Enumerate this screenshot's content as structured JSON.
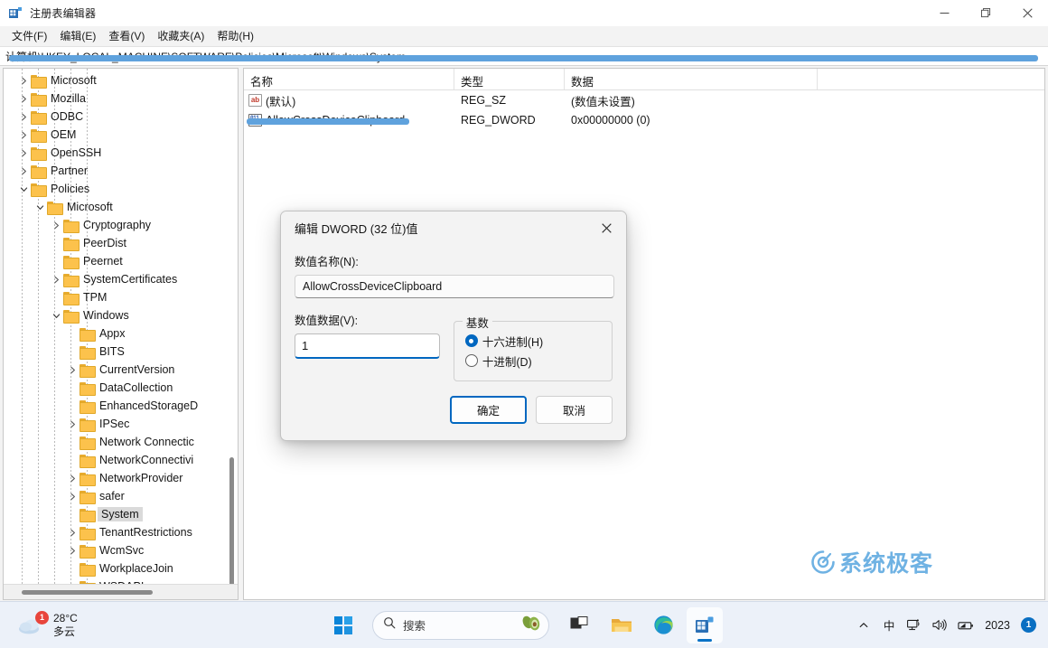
{
  "window": {
    "title": "注册表编辑器",
    "icon": "regedit-icon",
    "controls": {
      "minimize": "—",
      "maximize": "❐",
      "close": "✕"
    }
  },
  "menubar": {
    "items": [
      {
        "label": "文件(F)",
        "name": "menu-file"
      },
      {
        "label": "编辑(E)",
        "name": "menu-edit"
      },
      {
        "label": "查看(V)",
        "name": "menu-view"
      },
      {
        "label": "收藏夹(A)",
        "name": "menu-favorites"
      },
      {
        "label": "帮助(H)",
        "name": "menu-help"
      }
    ]
  },
  "address": {
    "path": "计算机\\HKEY_LOCAL_MACHINE\\SOFTWARE\\Policies\\Microsoft\\Windows\\System"
  },
  "tree": {
    "items": [
      {
        "label": "Microsoft",
        "indent": 1,
        "twisty": "collapsed"
      },
      {
        "label": "Mozilla",
        "indent": 1,
        "twisty": "collapsed"
      },
      {
        "label": "ODBC",
        "indent": 1,
        "twisty": "collapsed"
      },
      {
        "label": "OEM",
        "indent": 1,
        "twisty": "collapsed"
      },
      {
        "label": "OpenSSH",
        "indent": 1,
        "twisty": "collapsed"
      },
      {
        "label": "Partner",
        "indent": 1,
        "twisty": "collapsed"
      },
      {
        "label": "Policies",
        "indent": 1,
        "twisty": "expanded"
      },
      {
        "label": "Microsoft",
        "indent": 2,
        "twisty": "expanded"
      },
      {
        "label": "Cryptography",
        "indent": 3,
        "twisty": "collapsed"
      },
      {
        "label": "PeerDist",
        "indent": 3,
        "twisty": "none"
      },
      {
        "label": "Peernet",
        "indent": 3,
        "twisty": "none"
      },
      {
        "label": "SystemCertificates",
        "indent": 3,
        "twisty": "collapsed"
      },
      {
        "label": "TPM",
        "indent": 3,
        "twisty": "none"
      },
      {
        "label": "Windows",
        "indent": 3,
        "twisty": "expanded"
      },
      {
        "label": "Appx",
        "indent": 4,
        "twisty": "none"
      },
      {
        "label": "BITS",
        "indent": 4,
        "twisty": "none"
      },
      {
        "label": "CurrentVersion",
        "indent": 4,
        "twisty": "collapsed"
      },
      {
        "label": "DataCollection",
        "indent": 4,
        "twisty": "none"
      },
      {
        "label": "EnhancedStorageD",
        "indent": 4,
        "twisty": "none"
      },
      {
        "label": "IPSec",
        "indent": 4,
        "twisty": "collapsed"
      },
      {
        "label": "Network Connectic",
        "indent": 4,
        "twisty": "none"
      },
      {
        "label": "NetworkConnectivi",
        "indent": 4,
        "twisty": "none"
      },
      {
        "label": "NetworkProvider",
        "indent": 4,
        "twisty": "collapsed"
      },
      {
        "label": "safer",
        "indent": 4,
        "twisty": "collapsed"
      },
      {
        "label": "System",
        "indent": 4,
        "twisty": "none",
        "selected": true
      },
      {
        "label": "TenantRestrictions",
        "indent": 4,
        "twisty": "collapsed"
      },
      {
        "label": "WcmSvc",
        "indent": 4,
        "twisty": "collapsed"
      },
      {
        "label": "WorkplaceJoin",
        "indent": 4,
        "twisty": "none"
      },
      {
        "label": "WSDAPI",
        "indent": 4,
        "twisty": "collapsed"
      }
    ]
  },
  "list": {
    "columns": [
      "名称",
      "类型",
      "数据"
    ],
    "rows": [
      {
        "icon": "reg-sz-icon",
        "name": "(默认)",
        "type": "REG_SZ",
        "data": "(数值未设置)"
      },
      {
        "icon": "reg-dword-icon",
        "name": "AllowCrossDeviceClipboard",
        "type": "REG_DWORD",
        "data": "0x00000000 (0)"
      }
    ]
  },
  "dialog": {
    "title": "编辑 DWORD (32 位)值",
    "close": "✕",
    "name_label": "数值名称(N):",
    "name_value": "AllowCrossDeviceClipboard",
    "value_label": "数值数据(V):",
    "value_value": "1",
    "base_legend": "基数",
    "base_options": [
      {
        "label": "十六进制(H)",
        "selected": true
      },
      {
        "label": "十进制(D)",
        "selected": false
      }
    ],
    "ok_label": "确定",
    "cancel_label": "取消"
  },
  "watermark": {
    "text": "系统极客",
    "color": "#6fb2e3"
  },
  "taskbar": {
    "weather": {
      "temp": "28°C",
      "condition": "多云",
      "badge": "1"
    },
    "search_placeholder": "搜索",
    "apps": [
      {
        "name": "taskview",
        "label": "任务视图"
      },
      {
        "name": "file-explorer",
        "label": "文件资源管理器"
      },
      {
        "name": "edge",
        "label": "Microsoft Edge"
      },
      {
        "name": "regedit",
        "label": "注册表编辑器",
        "active": true
      }
    ],
    "tray": {
      "chevron": "⌃",
      "ime": "中",
      "network": "network-icon",
      "volume": "volume-icon",
      "battery": "battery-icon",
      "year": "2023",
      "badge": "1"
    }
  },
  "colors": {
    "accent": "#0067c0",
    "annotation": "#5fa2dd",
    "folder": "#fcc24c",
    "selection": "#dadada"
  }
}
